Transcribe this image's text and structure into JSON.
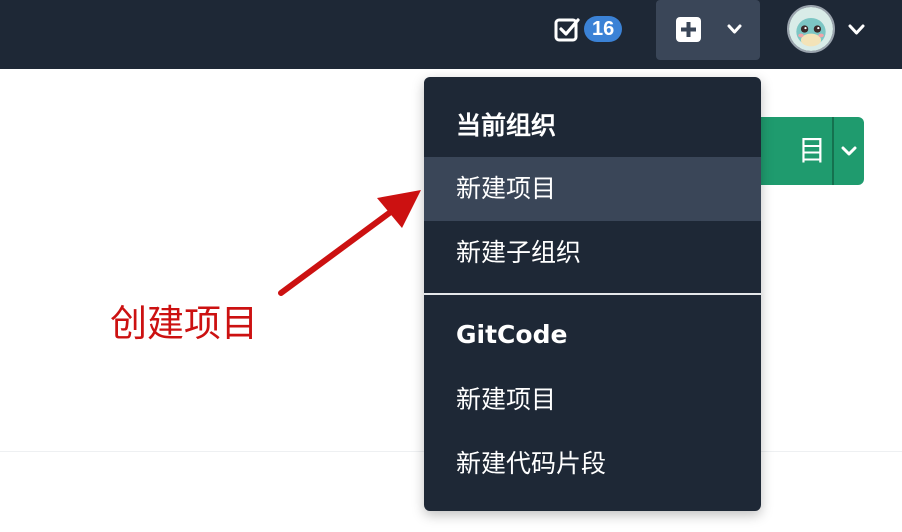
{
  "topbar": {
    "todo_count": "16",
    "colors": {
      "bar": "#1e2836",
      "badge": "#3b82d6"
    }
  },
  "background_button": {
    "label_fragment": "目",
    "color": "#1f9b6e"
  },
  "dropdown": {
    "section1_header": "当前组织",
    "section1_items": [
      "新建项目",
      "新建子组织"
    ],
    "section2_header": "GitCode",
    "section2_items": [
      "新建项目",
      "新建代码片段"
    ],
    "active_item": "新建项目"
  },
  "annotation": {
    "text": "创建项目",
    "color": "#cc1111"
  }
}
